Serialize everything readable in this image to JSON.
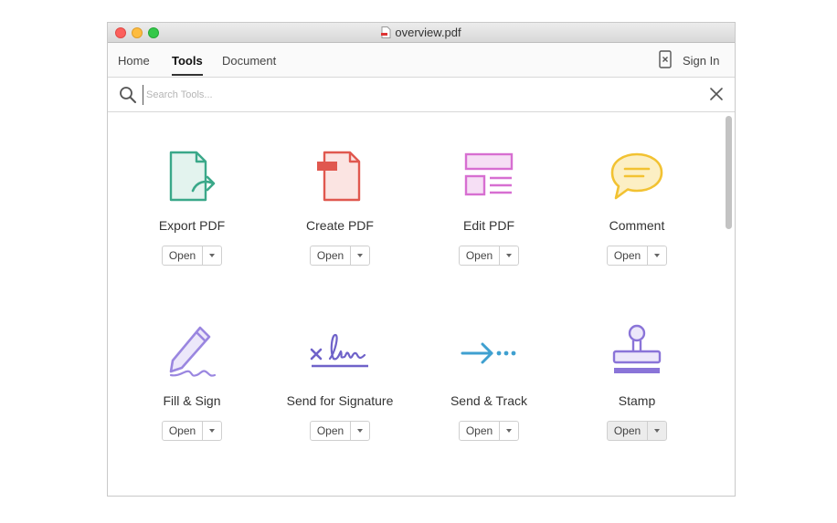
{
  "window": {
    "title": "overview.pdf"
  },
  "nav": {
    "home": "Home",
    "tools": "Tools",
    "document": "Document",
    "sign_in": "Sign In"
  },
  "search": {
    "placeholder": "Search Tools..."
  },
  "tools": [
    {
      "label": "Export PDF",
      "button": "Open",
      "icon": "export-pdf-icon",
      "color": "#3aa889"
    },
    {
      "label": "Create PDF",
      "button": "Open",
      "icon": "create-pdf-icon",
      "color": "#e0584f"
    },
    {
      "label": "Edit PDF",
      "button": "Open",
      "icon": "edit-pdf-icon",
      "color": "#d76fd1"
    },
    {
      "label": "Comment",
      "button": "Open",
      "icon": "comment-icon",
      "color": "#f2c232"
    },
    {
      "label": "Fill & Sign",
      "button": "Open",
      "icon": "fill-sign-icon",
      "color": "#9a86e0"
    },
    {
      "label": "Send for Signature",
      "button": "Open",
      "icon": "send-signature-icon",
      "color": "#6f62c9"
    },
    {
      "label": "Send & Track",
      "button": "Open",
      "icon": "send-track-icon",
      "color": "#3fa0d0"
    },
    {
      "label": "Stamp",
      "button": "Open",
      "icon": "stamp-icon",
      "color": "#8a74d8"
    }
  ]
}
